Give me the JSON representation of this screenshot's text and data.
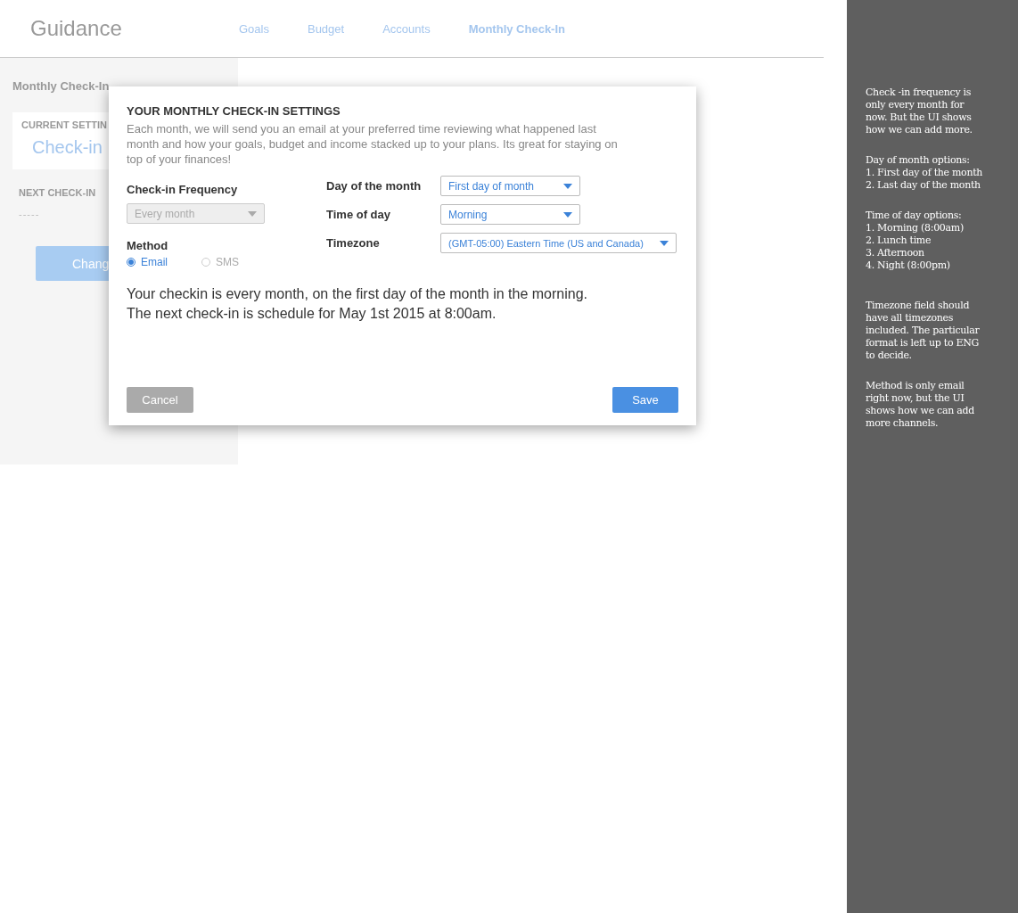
{
  "app": {
    "title": "Guidance"
  },
  "nav": [
    {
      "label": "Goals",
      "selected": false
    },
    {
      "label": "Budget",
      "selected": false
    },
    {
      "label": "Accounts",
      "selected": false
    },
    {
      "label": "Monthly Check-In",
      "selected": true
    }
  ],
  "scheduler": {
    "title": "Monthly Check-In",
    "current_label": "CURRENT SETTIN",
    "current_value": "Check-in",
    "next_label": "NEXT CHECK-IN",
    "next_value": "-----",
    "button": "Chang"
  },
  "dialog": {
    "title": "YOUR MONTHLY CHECK-IN SETTINGS",
    "description": "Each month, we will send you an email at your preferred time reviewing what happened last month and how your goals, budget and income stacked up to your plans. Its great for staying on top of your finances!",
    "frequency": {
      "label": "Check-in Frequency",
      "value": "Every month",
      "disabled": true
    },
    "method": {
      "label": "Method",
      "options": [
        {
          "label": "Email",
          "selected": true
        },
        {
          "label": "SMS",
          "selected": false
        }
      ]
    },
    "fields": [
      {
        "label": "Day of the month",
        "value": "First day of month",
        "kind": "short"
      },
      {
        "label": "Time of day",
        "value": "Morning",
        "kind": "short"
      },
      {
        "label": "Timezone",
        "value": "(GMT-05:00) Eastern Time (US and Canada)",
        "kind": "wide"
      }
    ],
    "summary": [
      "Your checkin is every month, on the first day of the month in the morning.",
      "The next check-in is schedule for May 1st 2015 at 8:00am."
    ],
    "cancel": "Cancel",
    "save": "Save"
  },
  "notes": [
    {
      "lines": [
        "Check -in frequency is",
        "only every month for",
        "now. But the UI shows",
        "how we can add more."
      ]
    },
    {
      "lines": [
        "Day of month options:",
        "1. First day of the month",
        "2. Last day of the month"
      ]
    },
    {
      "lines": [
        "Time of day options:",
        "1. Morning (8:00am)",
        "2. Lunch time",
        "3. Afternoon",
        "4. Night (8:00pm)"
      ]
    },
    {
      "lines": [
        "Timezone field should",
        "have all timezones",
        "included. The particular",
        "format is left up to ENG",
        "to decide."
      ]
    },
    {
      "lines": [
        "Method is only email",
        "right now, but the UI",
        "shows how we can add",
        "more channels."
      ]
    }
  ]
}
